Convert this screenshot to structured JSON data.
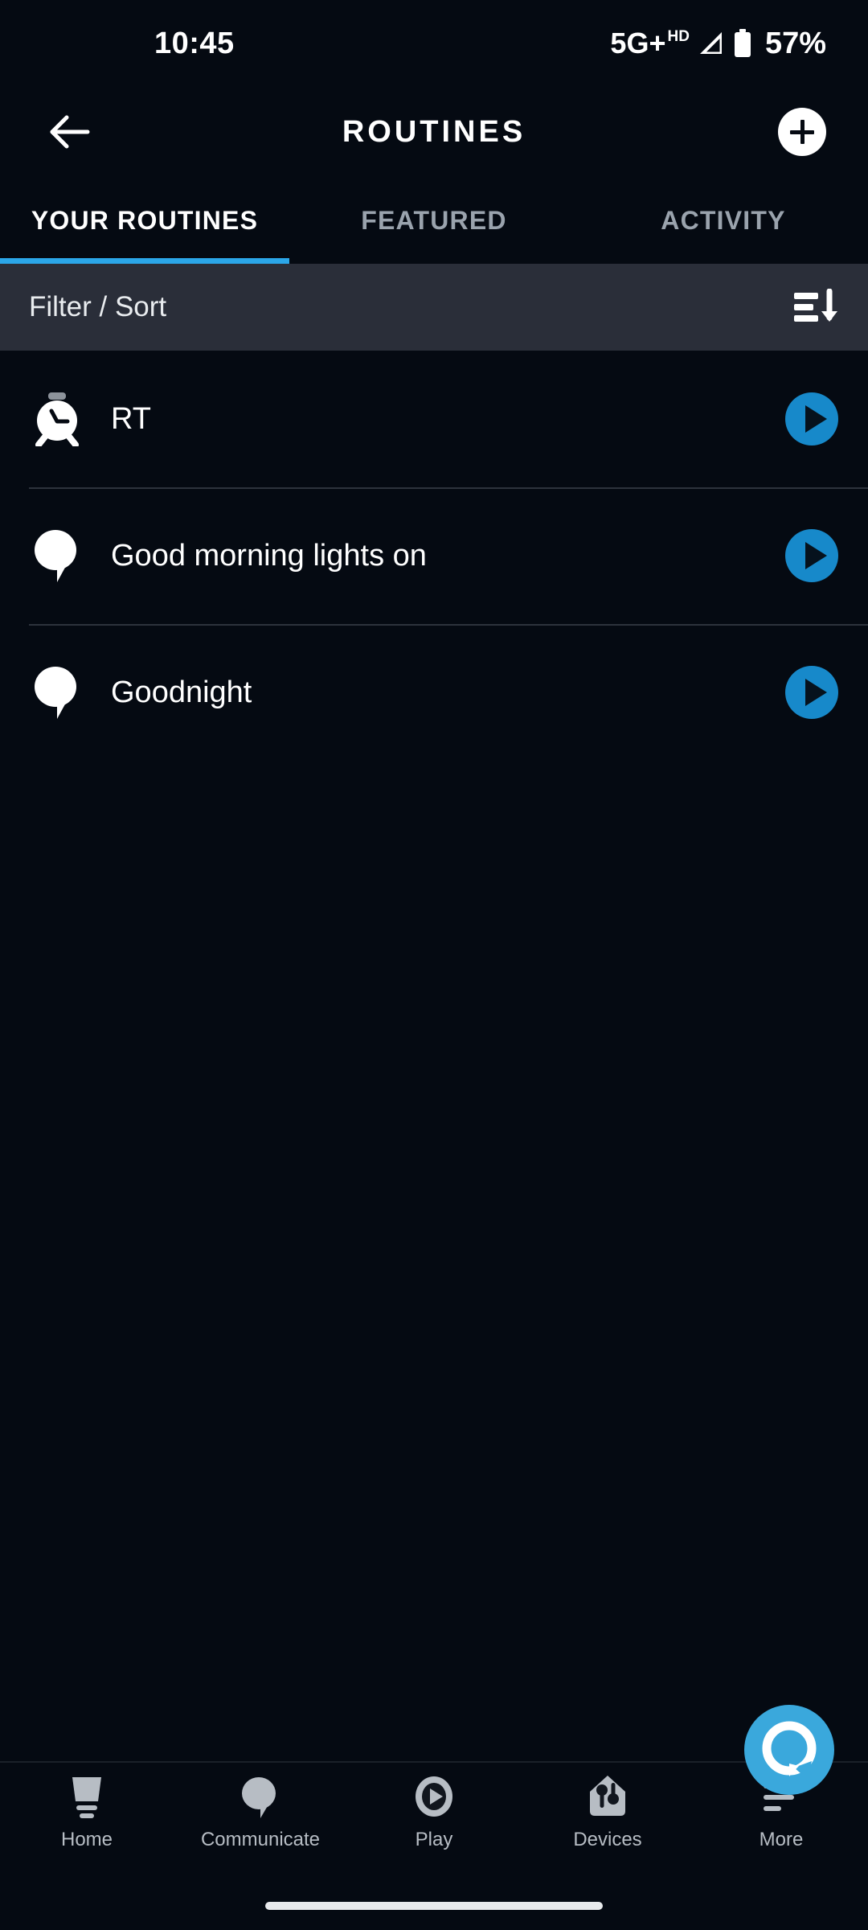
{
  "status_bar": {
    "time": "10:45",
    "network": "5G",
    "network_plus": "+",
    "hd_label": "HD",
    "battery_percent": "57%",
    "signal_icon": "signal-bars-icon",
    "battery_icon": "battery-icon"
  },
  "header": {
    "title": "ROUTINES",
    "back_icon": "back-arrow-icon",
    "add_icon": "plus-icon"
  },
  "tabs": [
    {
      "label": "YOUR ROUTINES",
      "active": true
    },
    {
      "label": "FEATURED",
      "active": false
    },
    {
      "label": "ACTIVITY",
      "active": false
    }
  ],
  "filter_bar": {
    "label": "Filter / Sort",
    "sort_icon": "sort-descending-icon"
  },
  "routines": [
    {
      "name": "RT",
      "icon": "alarm-clock-icon",
      "play_icon": "play-icon"
    },
    {
      "name": "Good morning lights on",
      "icon": "speech-bubble-icon",
      "play_icon": "play-icon"
    },
    {
      "name": "Goodnight",
      "icon": "speech-bubble-icon",
      "play_icon": "play-icon"
    }
  ],
  "alexa_button": {
    "label": "Alexa",
    "icon": "alexa-logo-icon"
  },
  "bottom_nav": [
    {
      "label": "Home",
      "icon": "home-icon"
    },
    {
      "label": "Communicate",
      "icon": "speech-bubble-icon"
    },
    {
      "label": "Play",
      "icon": "play-circle-icon"
    },
    {
      "label": "Devices",
      "icon": "devices-home-icon"
    },
    {
      "label": "More",
      "icon": "more-lines-icon"
    }
  ],
  "colors": {
    "background": "#050a12",
    "filter_bar": "#2a2e39",
    "accent_blue": "#2ba6e8",
    "play_blue": "#1789ca",
    "alexa_blue": "#3aa8dc",
    "text_primary": "#ffffff",
    "text_muted": "#9aa3ad",
    "divider": "#2d333c"
  }
}
